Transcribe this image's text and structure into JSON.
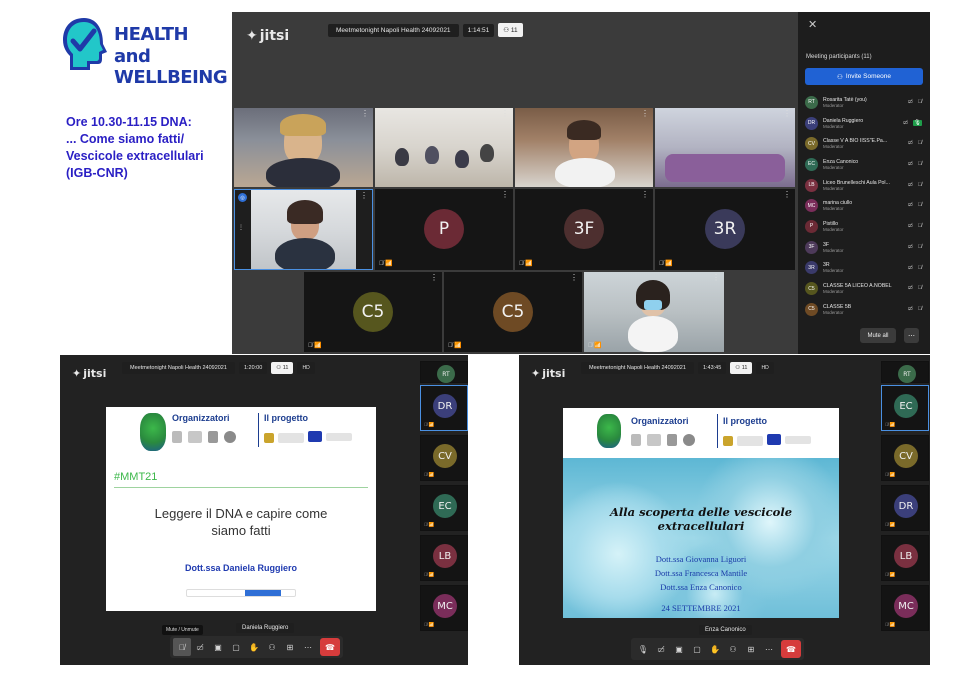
{
  "logo": {
    "line1": "HEALTH",
    "line2": "and WELLBEING"
  },
  "session_info": "Ore 10.30-11.15 DNA:\n... Come siamo fatti/\nVescicole extracellulari\n(IGB-CNR)",
  "main": {
    "jitsi": "jitsi",
    "title": "Meetmetonight Napoli Health 24092021",
    "time": "1:14:51",
    "count": "11",
    "tiles": [
      {
        "initials": "P",
        "color": "#6b2a35"
      },
      {
        "initials": "3F",
        "color": "#4d2f2f"
      },
      {
        "initials": "3R",
        "color": "#3a3a5a"
      },
      {
        "initials": "C5",
        "color": "#56561e"
      },
      {
        "initials": "C5",
        "color": "#6e4a24"
      }
    ],
    "panel": {
      "title": "Meeting participants (11)",
      "invite": "Invite Someone",
      "mute_all": "Mute all",
      "participants": [
        {
          "initials": "RT",
          "name": "Rosarita Tatè (you)",
          "role": "Moderator",
          "color": "#3b6b4a"
        },
        {
          "initials": "DR",
          "name": "Daniela Ruggiero",
          "role": "Moderator",
          "color": "#3b3f7a"
        },
        {
          "initials": "CV",
          "name": "Classe V A BIO IISS\"E.Pa...",
          "role": "Moderator",
          "color": "#7a6a2a"
        },
        {
          "initials": "EC",
          "name": "Enza Canonico",
          "role": "Moderator",
          "color": "#2f6a55"
        },
        {
          "initials": "LB",
          "name": "Liceo Brunelleschi Aula Pol...",
          "role": "Moderator",
          "color": "#7a3040"
        },
        {
          "initials": "MC",
          "name": "marina ciullo",
          "role": "Moderator",
          "color": "#7a2d5a"
        },
        {
          "initials": "P",
          "name": "Pistillo",
          "role": "Moderator",
          "color": "#6b2a35"
        },
        {
          "initials": "3F",
          "name": "3F",
          "role": "Moderator",
          "color": "#4d3a5a"
        },
        {
          "initials": "3R",
          "name": "3R",
          "role": "Moderator",
          "color": "#3a3a6a"
        },
        {
          "initials": "C5",
          "name": "CLASSE 5A LICEO A.NOBEL",
          "role": "Moderator",
          "color": "#56561e"
        },
        {
          "initials": "C5",
          "name": "CLASSE 5B",
          "role": "Moderator",
          "color": "#6e4a24"
        }
      ]
    }
  },
  "left_window": {
    "jitsi": "jitsi",
    "title": "Meetmetonight Napoli Health 24092021",
    "time": "1:20:00",
    "count": "11",
    "hd": "HD",
    "slide": {
      "org": "Organizzatori",
      "project": "Il progetto",
      "tag": "#MMT21",
      "title_line1": "Leggere il DNA e capire come",
      "title_line2": "siamo fatti",
      "author": "Dott.ssa Daniela Ruggiero"
    },
    "tooltip": "Mute / Unmute",
    "name_label": "Daniela Ruggiero",
    "thumbs": [
      {
        "initials": "RT",
        "color": "#3b6b4a"
      },
      {
        "initials": "DR",
        "color": "#3b3f7a"
      },
      {
        "initials": "CV",
        "color": "#7a6a2a"
      },
      {
        "initials": "EC",
        "color": "#2f6a55"
      },
      {
        "initials": "LB",
        "color": "#7a3040"
      },
      {
        "initials": "MC",
        "color": "#7a2d5a"
      }
    ]
  },
  "right_window": {
    "jitsi": "jitsi",
    "title": "Meetmetonight Napoli Health 24092021",
    "time": "1:43:45",
    "count": "11",
    "hd": "HD",
    "slide": {
      "org": "Organizzatori",
      "project": "Il progetto",
      "title_line1": "Alla scoperta delle vescicole",
      "title_line2": "extracellulari",
      "author1": "Dott.ssa Giovanna Liguori",
      "author2": "Dott.ssa Francesca Mantile",
      "author3": "Dott.ssa Enza Canonico",
      "date": "24 SETTEMBRE 2021"
    },
    "name_label": "Enza Canonico",
    "thumbs": [
      {
        "initials": "RT",
        "color": "#3b6b4a"
      },
      {
        "initials": "EC",
        "color": "#2f6a55"
      },
      {
        "initials": "CV",
        "color": "#7a6a2a"
      },
      {
        "initials": "DR",
        "color": "#3b3f7a"
      },
      {
        "initials": "LB",
        "color": "#7a3040"
      },
      {
        "initials": "MC",
        "color": "#7a2d5a"
      }
    ]
  }
}
